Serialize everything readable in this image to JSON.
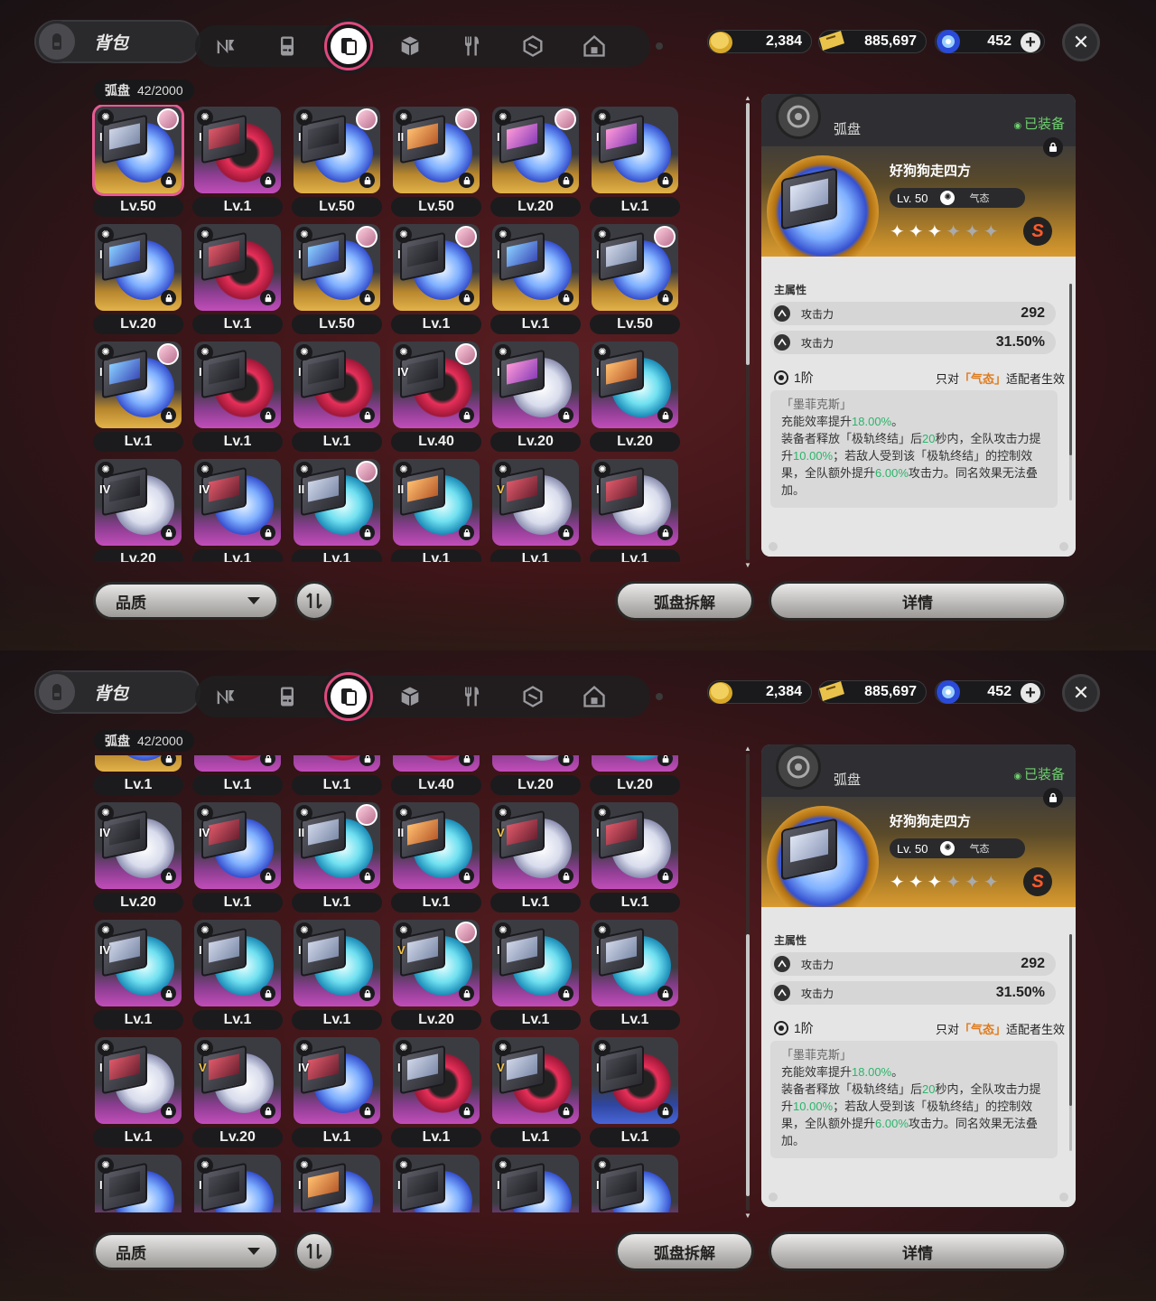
{
  "header": {
    "title": "背包",
    "tabs": [
      {
        "icon": "agent-icon"
      },
      {
        "icon": "gameboy-icon"
      },
      {
        "icon": "disc-drive-icon",
        "active": true
      },
      {
        "icon": "box-icon"
      },
      {
        "icon": "food-icon"
      },
      {
        "icon": "cube-pack-icon"
      },
      {
        "icon": "home-icon"
      }
    ],
    "currencies": [
      {
        "icon": "gold-coin-icon",
        "value": "2,384"
      },
      {
        "icon": "ticket-icon",
        "value": "885,697"
      },
      {
        "icon": "blue-orb-icon",
        "value": "452"
      }
    ]
  },
  "inventory": {
    "label": "弧盘",
    "count": "42/2000"
  },
  "grid1": [
    {
      "lv": "Lv.50",
      "rank": "I",
      "tier": "gold",
      "disc": "wb",
      "box": "",
      "avatar": true,
      "sel": true
    },
    {
      "lv": "Lv.1",
      "rank": "I",
      "tier": "purple",
      "disc": "rd",
      "box": "r"
    },
    {
      "lv": "Lv.50",
      "rank": "I",
      "tier": "gold",
      "disc": "wb",
      "box": "d",
      "avatar": true
    },
    {
      "lv": "Lv.50",
      "rank": "II",
      "tier": "gold",
      "disc": "wb",
      "box": "o",
      "avatar": true
    },
    {
      "lv": "Lv.20",
      "rank": "I",
      "tier": "gold",
      "disc": "wb",
      "box": "p",
      "avatar": true
    },
    {
      "lv": "Lv.1",
      "rank": "I",
      "tier": "gold",
      "disc": "wb",
      "box": "p"
    },
    {
      "lv": "Lv.20",
      "rank": "I",
      "tier": "gold",
      "disc": "wb",
      "box": "b"
    },
    {
      "lv": "Lv.1",
      "rank": "I",
      "tier": "purple",
      "disc": "rd",
      "box": "r"
    },
    {
      "lv": "Lv.50",
      "rank": "I",
      "tier": "gold",
      "disc": "wb",
      "box": "b",
      "avatar": true
    },
    {
      "lv": "Lv.1",
      "rank": "I",
      "tier": "gold",
      "disc": "wb",
      "box": "d",
      "avatar": true
    },
    {
      "lv": "Lv.1",
      "rank": "I",
      "tier": "gold",
      "disc": "wb",
      "box": "b"
    },
    {
      "lv": "Lv.50",
      "rank": "I",
      "tier": "gold",
      "disc": "wb",
      "box": "",
      "avatar": true
    },
    {
      "lv": "Lv.1",
      "rank": "I",
      "tier": "gold",
      "disc": "wb",
      "box": "b",
      "avatar": true
    },
    {
      "lv": "Lv.1",
      "rank": "I",
      "tier": "purple",
      "disc": "rd",
      "box": "d"
    },
    {
      "lv": "Lv.1",
      "rank": "I",
      "tier": "purple",
      "disc": "rd",
      "box": "d"
    },
    {
      "lv": "Lv.40",
      "rank": "IV",
      "tier": "purple",
      "disc": "rd",
      "box": "d",
      "avatar": true
    },
    {
      "lv": "Lv.20",
      "rank": "I",
      "tier": "purple",
      "disc": "wh",
      "box": "p"
    },
    {
      "lv": "Lv.20",
      "rank": "I",
      "tier": "purple",
      "disc": "cy",
      "box": "o"
    },
    {
      "lv": "Lv.20",
      "rank": "IV",
      "tier": "purple",
      "disc": "wh",
      "box": "d"
    },
    {
      "lv": "Lv.1",
      "rank": "IV",
      "tier": "purple",
      "disc": "wb",
      "box": "r"
    },
    {
      "lv": "Lv.1",
      "rank": "II",
      "tier": "purple",
      "disc": "cy",
      "box": "",
      "avatar": true
    },
    {
      "lv": "Lv.1",
      "rank": "II",
      "tier": "purple",
      "disc": "cy",
      "box": "o"
    },
    {
      "lv": "Lv.1",
      "rank": "V",
      "tier": "purple",
      "disc": "wh",
      "box": "r",
      "gold": true
    },
    {
      "lv": "Lv.1",
      "rank": "I",
      "tier": "purple",
      "disc": "wh",
      "box": "r"
    }
  ],
  "grid2": [
    {
      "lv": "Lv.1",
      "rank": "",
      "tier": "gold",
      "disc": "wb",
      "box": ""
    },
    {
      "lv": "Lv.1",
      "rank": "",
      "tier": "purple",
      "disc": "rd",
      "box": ""
    },
    {
      "lv": "Lv.1",
      "rank": "",
      "tier": "purple",
      "disc": "rd",
      "box": ""
    },
    {
      "lv": "Lv.40",
      "rank": "",
      "tier": "purple",
      "disc": "rd",
      "box": ""
    },
    {
      "lv": "Lv.20",
      "rank": "",
      "tier": "purple",
      "disc": "wh",
      "box": ""
    },
    {
      "lv": "Lv.20",
      "rank": "",
      "tier": "purple",
      "disc": "cy",
      "box": ""
    },
    {
      "lv": "Lv.20",
      "rank": "IV",
      "tier": "purple",
      "disc": "wh",
      "box": "d"
    },
    {
      "lv": "Lv.1",
      "rank": "IV",
      "tier": "purple",
      "disc": "wb",
      "box": "r"
    },
    {
      "lv": "Lv.1",
      "rank": "II",
      "tier": "purple",
      "disc": "cy",
      "box": "",
      "avatar": true
    },
    {
      "lv": "Lv.1",
      "rank": "II",
      "tier": "purple",
      "disc": "cy",
      "box": "o"
    },
    {
      "lv": "Lv.1",
      "rank": "V",
      "tier": "purple",
      "disc": "wh",
      "box": "r",
      "gold": true
    },
    {
      "lv": "Lv.1",
      "rank": "I",
      "tier": "purple",
      "disc": "wh",
      "box": "r"
    },
    {
      "lv": "Lv.1",
      "rank": "IV",
      "tier": "purple",
      "disc": "cy",
      "box": ""
    },
    {
      "lv": "Lv.1",
      "rank": "I",
      "tier": "purple",
      "disc": "cy",
      "box": ""
    },
    {
      "lv": "Lv.1",
      "rank": "I",
      "tier": "purple",
      "disc": "cy",
      "box": ""
    },
    {
      "lv": "Lv.20",
      "rank": "V",
      "tier": "purple",
      "disc": "cy",
      "box": "",
      "avatar": true,
      "gold": true
    },
    {
      "lv": "Lv.1",
      "rank": "I",
      "tier": "purple",
      "disc": "cy",
      "box": ""
    },
    {
      "lv": "Lv.1",
      "rank": "I",
      "tier": "purple",
      "disc": "cy",
      "box": ""
    },
    {
      "lv": "Lv.1",
      "rank": "I",
      "tier": "purple",
      "disc": "wh",
      "box": "r"
    },
    {
      "lv": "Lv.20",
      "rank": "V",
      "tier": "purple",
      "disc": "wh",
      "box": "r",
      "gold": true
    },
    {
      "lv": "Lv.1",
      "rank": "IV",
      "tier": "purple",
      "disc": "wb",
      "box": "r"
    },
    {
      "lv": "Lv.1",
      "rank": "I",
      "tier": "purple",
      "disc": "rd",
      "box": ""
    },
    {
      "lv": "Lv.1",
      "rank": "V",
      "tier": "purple",
      "disc": "rd",
      "box": "",
      "gold": true
    },
    {
      "lv": "Lv.1",
      "rank": "I",
      "tier": "blue",
      "disc": "rd",
      "box": "d"
    },
    {
      "lv": "",
      "rank": "I",
      "tier": "purple",
      "disc": "wb",
      "box": "d"
    },
    {
      "lv": "",
      "rank": "I",
      "tier": "purple",
      "disc": "wb",
      "box": "d"
    },
    {
      "lv": "",
      "rank": "I",
      "tier": "purple",
      "disc": "wb",
      "box": "o"
    },
    {
      "lv": "",
      "rank": "I",
      "tier": "purple",
      "disc": "wb",
      "box": "d"
    },
    {
      "lv": "",
      "rank": "I",
      "tier": "purple",
      "disc": "wb",
      "box": "d"
    },
    {
      "lv": "",
      "rank": "I",
      "tier": "purple",
      "disc": "wb",
      "box": "d"
    }
  ],
  "detail": {
    "type": "弧盘",
    "equipped": "已装备",
    "name": "好狗狗走四方",
    "level": "Lv. 50",
    "attribute": "气态",
    "stars_on": 3,
    "stars_total": 6,
    "grade": "S",
    "main_label": "主属性",
    "stats": [
      {
        "name": "攻击力",
        "value": "292"
      },
      {
        "name": "攻击力",
        "value": "31.50%"
      }
    ],
    "tier": "1阶",
    "restrict_pre": "只对",
    "restrict_hl": "「气态」",
    "restrict_post": "适配者生效",
    "effect_title": "「墨菲克斯」",
    "effect_line1_pre": "充能效率提升",
    "effect_line1_val": "18.00%",
    "effect_line1_post": "。",
    "effect_p1": "装备者释放「极轨终结」后",
    "effect_v1": "20",
    "effect_p2": "秒内，全队攻击力提升",
    "effect_v2": "10.00%",
    "effect_p3": "；若敌人受到该「极轨终结」的控制效果，全队额外提升",
    "effect_v3": "6.00%",
    "effect_p4": "攻击力。同名效果无法叠加。"
  },
  "footer": {
    "filter": "品质",
    "dismantle": "弧盘拆解",
    "details": "详情"
  },
  "colors": {
    "accent": "#e0497c",
    "green": "#2bb56a",
    "orange": "#e07a1a"
  }
}
